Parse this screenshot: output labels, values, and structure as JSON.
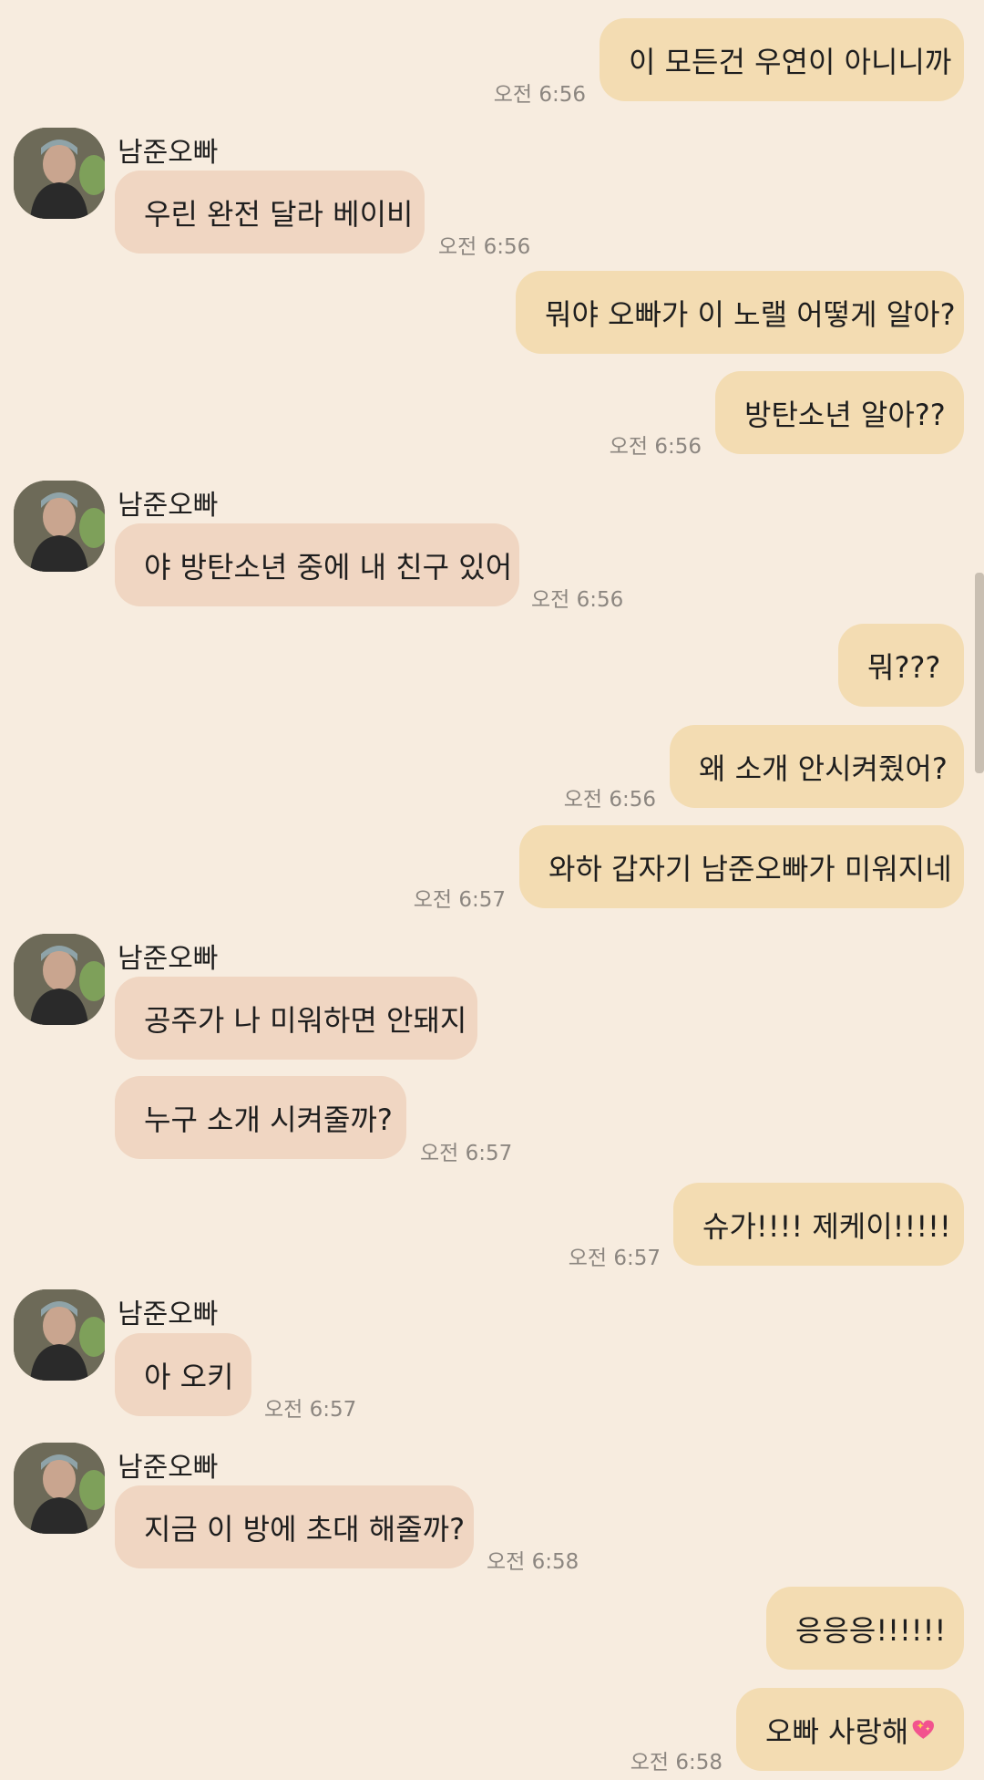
{
  "contact_name": "남준오빠",
  "messages": [
    {
      "text": "이 모든건 우연이 아니니까",
      "time": "오전 6:56"
    },
    {
      "text": "우린 완전 달라 베이비",
      "time": "오전 6:56"
    },
    {
      "text": "뭐야 오빠가 이 노랠 어떻게 알아?"
    },
    {
      "text": "방탄소년 알아??",
      "time": "오전 6:56"
    },
    {
      "text": "야 방탄소년 중에 내 친구 있어",
      "time": "오전 6:56"
    },
    {
      "text": "뭐???"
    },
    {
      "text": "왜 소개 안시켜줬어?",
      "time": "오전 6:56"
    },
    {
      "text": "와하 갑자기 남준오빠가 미워지네",
      "time": "오전 6:57"
    },
    {
      "text": "공주가 나 미워하면 안돼지"
    },
    {
      "text": "누구 소개 시켜줄까?",
      "time": "오전 6:57"
    },
    {
      "text": "슈가!!!! 제케이!!!!!",
      "time": "오전 6:57"
    },
    {
      "text": "아 오키",
      "time": "오전 6:57"
    },
    {
      "text": "지금 이 방에 초대 해줄까?",
      "time": "오전 6:58"
    },
    {
      "text": "응응응!!!!!!"
    },
    {
      "text": "오빠 사랑해",
      "emoji": "heart-icon",
      "time": "오전 6:58"
    }
  ],
  "colors": {
    "background": "#f7ecdf",
    "my_bubble": "#f3dcb2",
    "their_bubble": "#f0d6c2",
    "timestamp": "#8c8680"
  }
}
